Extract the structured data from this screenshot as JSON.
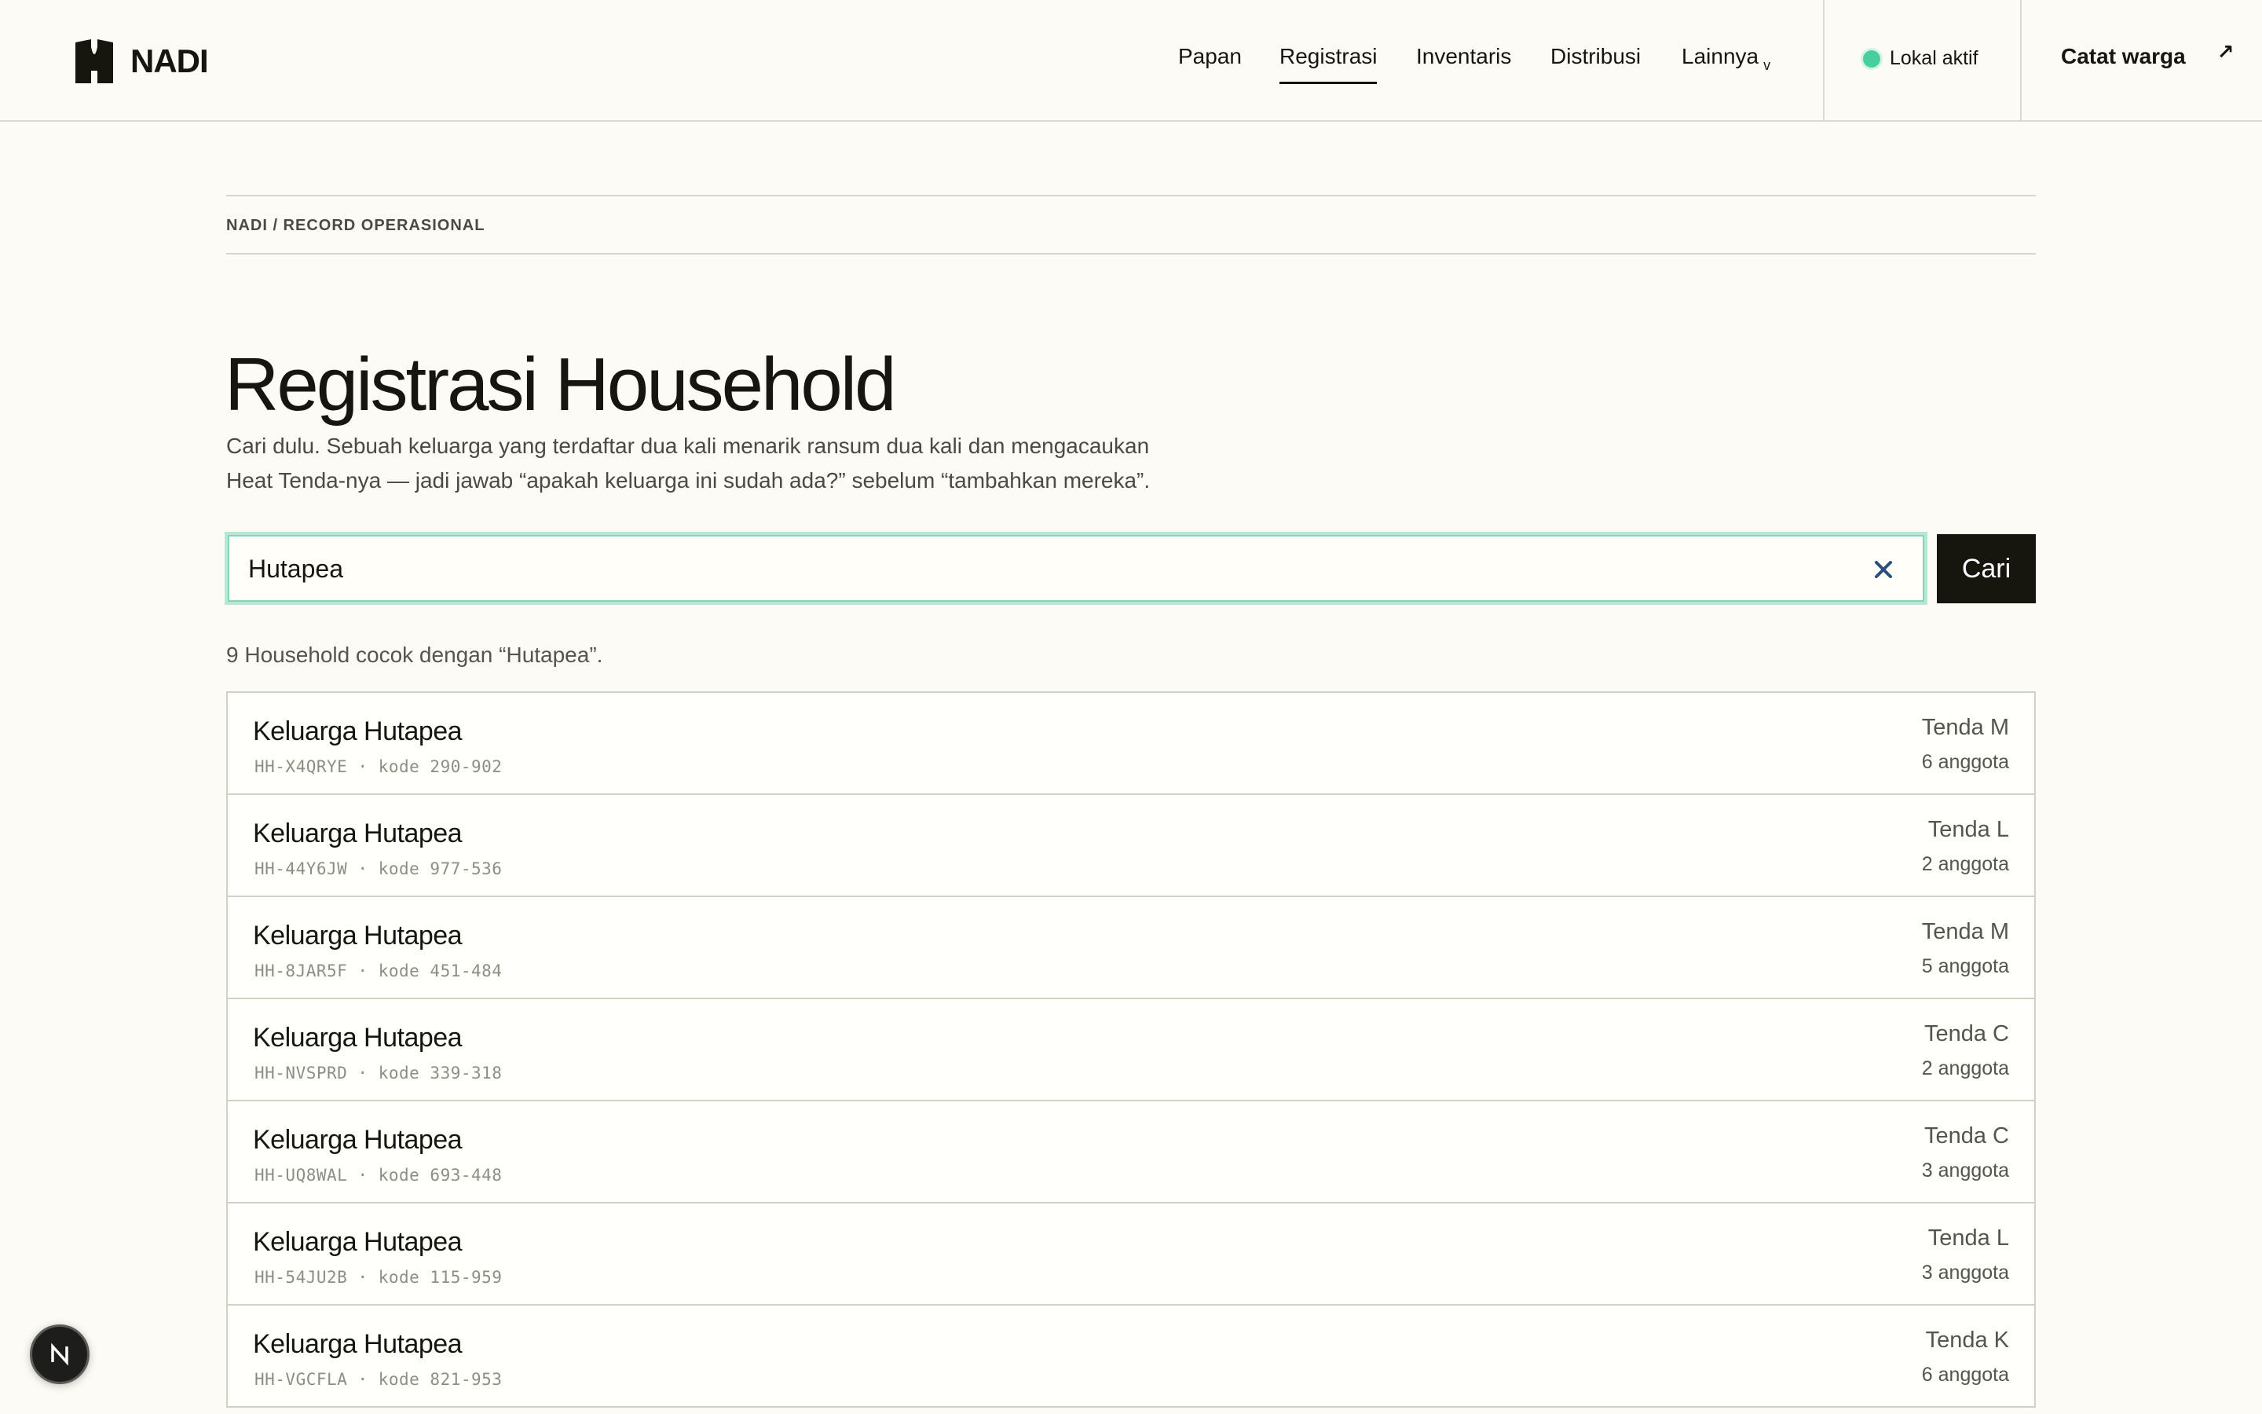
{
  "brand": {
    "name": "NADI"
  },
  "nav": {
    "items": [
      {
        "label": "Papan"
      },
      {
        "label": "Registrasi"
      },
      {
        "label": "Inventaris"
      },
      {
        "label": "Distribusi"
      },
      {
        "label": "Lainnya"
      }
    ],
    "active": "Registrasi",
    "status_label": "Lokal aktif",
    "cta_label": "Catat warga"
  },
  "breadcrumb": "NADI / RECORD OPERASIONAL",
  "page": {
    "title": "Registrasi Household",
    "lede_line1": "Cari dulu. Sebuah keluarga yang terdaftar dua kali menarik ransum dua kali dan mengacaukan",
    "lede_line2": "Heat Tenda-nya — jadi jawab “apakah keluarga ini sudah ada?” sebelum “tambahkan mereka”."
  },
  "search": {
    "value": "Hutapea",
    "button_label": "Cari"
  },
  "results": {
    "count_text": "9 Household cocok dengan “Hutapea”.",
    "rows": [
      {
        "name": "Keluarga Hutapea",
        "meta": "HH-X4QRYE · kode 290-902",
        "tent": "Tenda M",
        "members": "6 anggota"
      },
      {
        "name": "Keluarga Hutapea",
        "meta": "HH-44Y6JW · kode 977-536",
        "tent": "Tenda L",
        "members": "2 anggota"
      },
      {
        "name": "Keluarga Hutapea",
        "meta": "HH-8JAR5F · kode 451-484",
        "tent": "Tenda M",
        "members": "5 anggota"
      },
      {
        "name": "Keluarga Hutapea",
        "meta": "HH-NVSPRD · kode 339-318",
        "tent": "Tenda C",
        "members": "2 anggota"
      },
      {
        "name": "Keluarga Hutapea",
        "meta": "HH-UQ8WAL · kode 693-448",
        "tent": "Tenda C",
        "members": "3 anggota"
      },
      {
        "name": "Keluarga Hutapea",
        "meta": "HH-54JU2B · kode 115-959",
        "tent": "Tenda L",
        "members": "3 anggota"
      },
      {
        "name": "Keluarga Hutapea",
        "meta": "HH-VGCFLA · kode 821-953",
        "tent": "Tenda K",
        "members": "6 anggota"
      }
    ]
  },
  "badge": {
    "letter": "N"
  },
  "colors": {
    "accent": "#49cf9f",
    "ink": "#16160f",
    "paper": "#fcfbf5",
    "clear_icon": "#2a4e7e"
  }
}
